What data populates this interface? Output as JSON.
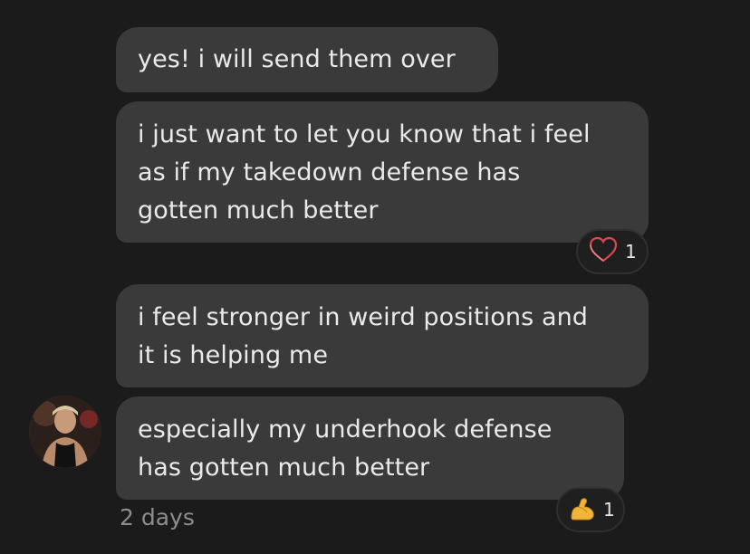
{
  "messages": [
    {
      "text": "yes! i will send them over"
    },
    {
      "text": "i just want to let you know that i feel\nas if my takedown defense has\ngotten much better",
      "reaction": {
        "icon": "heart-icon",
        "count": "1"
      }
    },
    {
      "text": "i feel stronger in weird positions and\nit is helping me"
    },
    {
      "text": "especially my underhook defense\nhas gotten much better",
      "reaction": {
        "icon": "flexed-biceps-icon",
        "count": "1"
      }
    }
  ],
  "timestamp": "2 days",
  "colors": {
    "background": "#1b1b1b",
    "bubble": "#3a3a3a",
    "text": "#eaeaea",
    "muted": "#8d8d8d",
    "heart": "#d8484f",
    "biceps": "#f0b53a"
  }
}
